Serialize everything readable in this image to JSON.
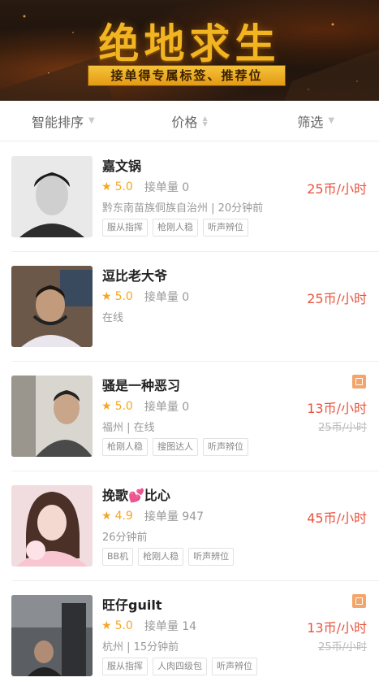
{
  "banner": {
    "title": "绝地求生",
    "subtitle": "接单得专属标签、推荐位"
  },
  "filters": {
    "sort_label": "智能排序",
    "price_label": "价格",
    "filter_label": "筛选"
  },
  "list": [
    {
      "name": "嘉文锅",
      "rating": "5.0",
      "orders_label": "接单量 0",
      "location": "黔东南苗族侗族自治州 | 20分钟前",
      "price": "25币/小时",
      "old_price": "",
      "badge": false,
      "tags": [
        "服从指挥",
        "枪刚人稳",
        "听声辨位"
      ]
    },
    {
      "name": "逗比老大爷",
      "rating": "5.0",
      "orders_label": "接单量 0",
      "location": "在线",
      "price": "25币/小时",
      "old_price": "",
      "badge": false,
      "tags": []
    },
    {
      "name": "骚是一种恶习",
      "rating": "5.0",
      "orders_label": "接单量 0",
      "location": "福州 | 在线",
      "price": "13币/小时",
      "old_price": "25币/小时",
      "badge": true,
      "tags": [
        "枪刚人稳",
        "搜图达人",
        "听声辨位"
      ]
    },
    {
      "name": "挽歌💕比心",
      "rating": "4.9",
      "orders_label": "接单量 947",
      "location": "26分钟前",
      "price": "45币/小时",
      "old_price": "",
      "badge": false,
      "tags": [
        "BB机",
        "枪刚人稳",
        "听声辨位"
      ]
    },
    {
      "name": "旺仔guilt",
      "rating": "5.0",
      "orders_label": "接单量 14",
      "location": "杭州 | 15分钟前",
      "price": "13币/小时",
      "old_price": "25币/小时",
      "badge": true,
      "tags": [
        "服从指挥",
        "人肉四级包",
        "听声辨位"
      ]
    }
  ]
}
